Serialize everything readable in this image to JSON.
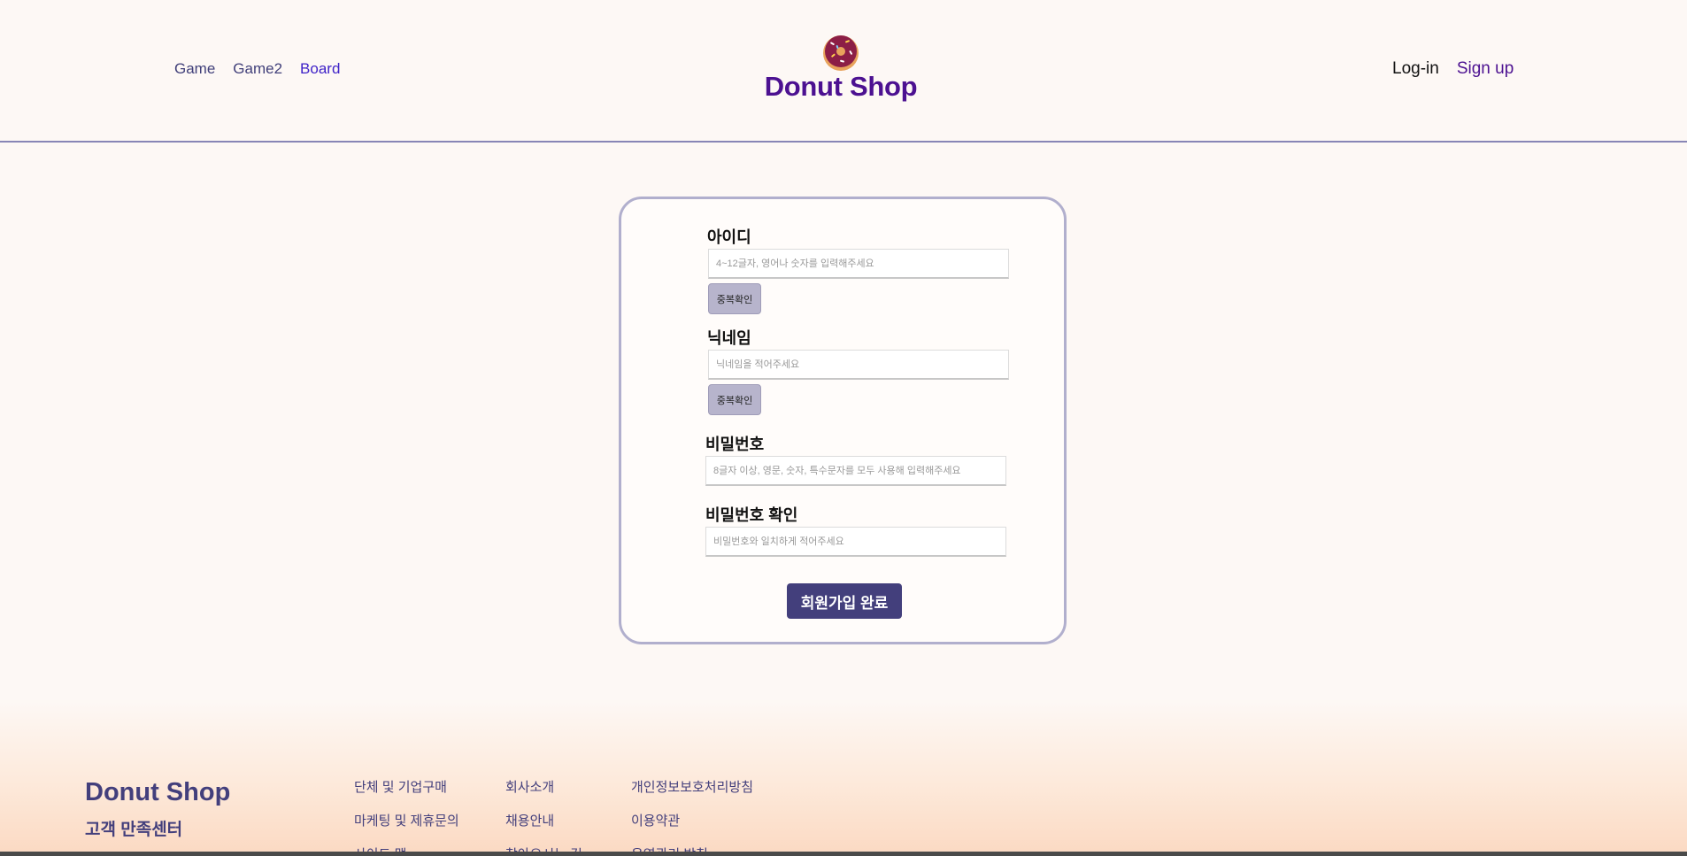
{
  "header": {
    "nav_left": [
      "Game",
      "Game2",
      "Board"
    ],
    "brand": "Donut Shop",
    "logo_icon": "donut-icon",
    "nav_right": {
      "login": "Log-in",
      "signup": "Sign up"
    }
  },
  "form": {
    "id": {
      "label": "아이디",
      "placeholder": "4~12글자, 영어나 숫자를 입력해주세요",
      "check_button": "중복확인"
    },
    "nickname": {
      "label": "닉네임",
      "placeholder": "닉네임을 적어주세요",
      "check_button": "중복확인"
    },
    "password": {
      "label": "비밀번호",
      "placeholder": "8글자 이상, 영문, 숫자, 특수문자를 모두 사용해 입력해주세요"
    },
    "password_confirm": {
      "label": "비밀번호 확인",
      "placeholder": "비밀번호와 일치하게 적어주세요"
    },
    "submit": "회원가입 완료"
  },
  "footer": {
    "brand": "Donut Shop",
    "customer_center": "고객 만족센터",
    "col1": [
      "단체 및 기업구매",
      "마케팅 및 제휴문의",
      "사이트 맵"
    ],
    "col2": [
      "회사소개",
      "채용안내",
      "찾아오시는 길"
    ],
    "col3": [
      "개인정보보호처리방침",
      "이용약관",
      "운영관리 방침"
    ]
  },
  "colors": {
    "brand": "#4c1191",
    "accent": "#433f7c",
    "card_border": "#b1afcd",
    "background": "#fdf8f5"
  }
}
